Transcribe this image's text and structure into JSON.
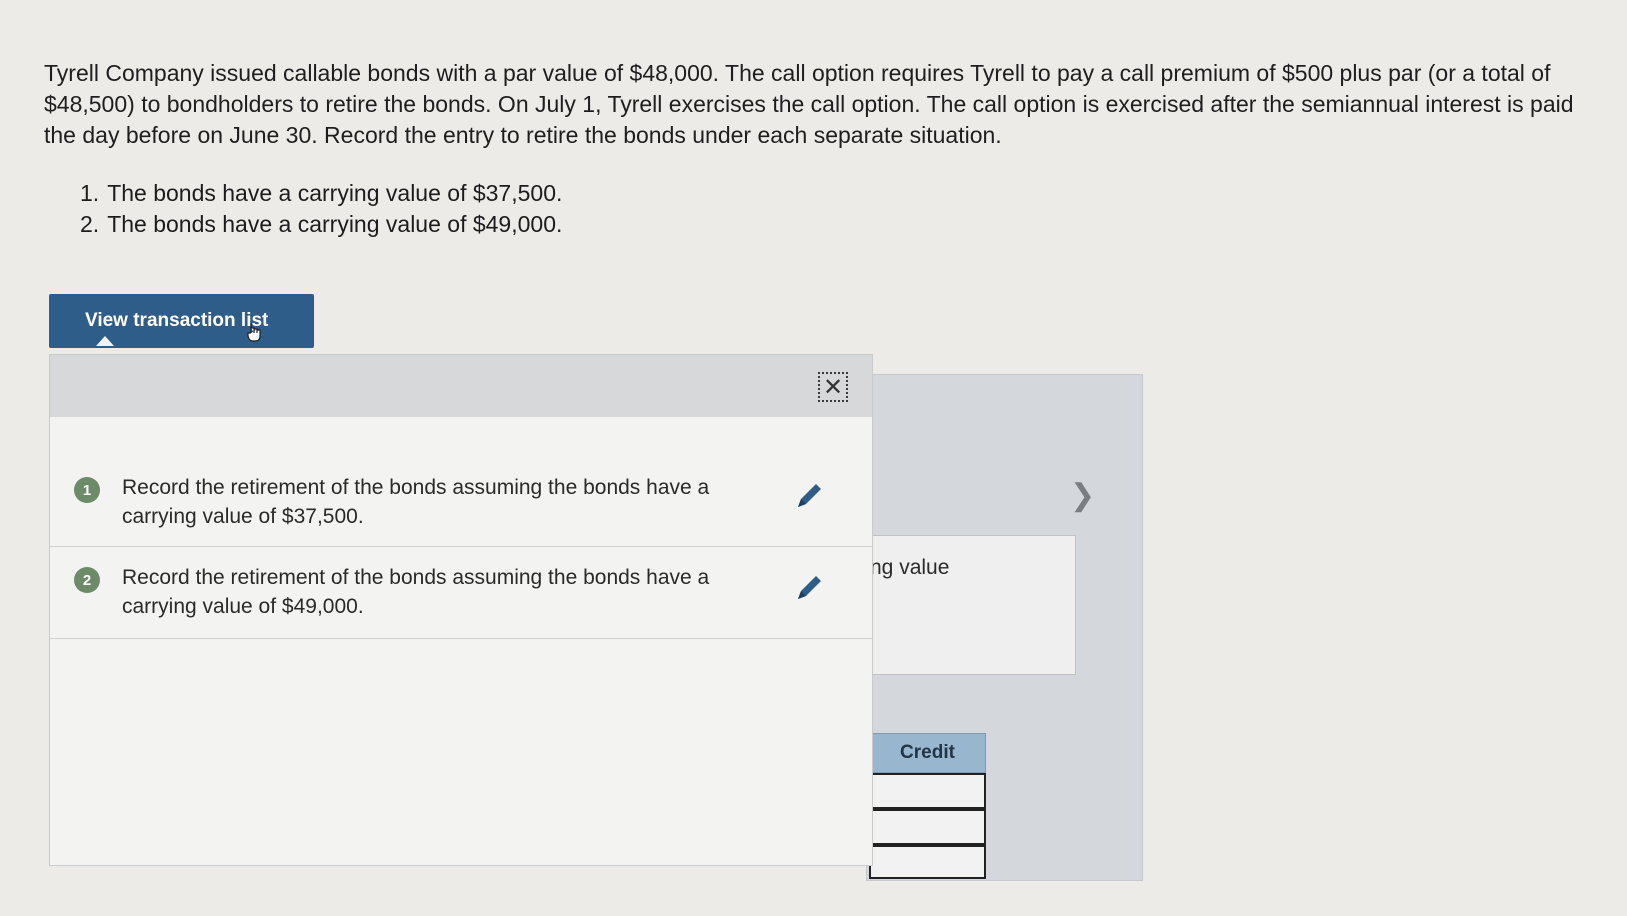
{
  "problem": {
    "text": "Tyrell Company issued callable bonds with a par value of $48,000. The call option requires Tyrell to pay a call premium of $500 plus par (or a total of $48,500) to bondholders to retire the bonds. On July 1, Tyrell exercises the call option. The call option is exercised after the semiannual interest is paid the day before on June 30. Record the entry to retire the bonds under each separate situation.",
    "requirements": [
      {
        "num": "1.",
        "text": "The bonds have a carrying value of $37,500."
      },
      {
        "num": "2.",
        "text": "The bonds have a carrying value of $49,000."
      }
    ]
  },
  "view_button": {
    "label": "View transaction list"
  },
  "popup": {
    "close_icon": "close-icon",
    "items": [
      {
        "num": "1",
        "text": "Record the retirement of the bonds assuming the bonds have a carrying value of $37,500."
      },
      {
        "num": "2",
        "text": "Record the retirement of the bonds assuming the bonds have a carrying value of $49,000."
      }
    ]
  },
  "background": {
    "partial_label": "ng value",
    "credit_header": "Credit",
    "chevron_icon": "chevron-right-icon"
  },
  "colors": {
    "button": "#2f5d8a",
    "badge": "#6d8b68",
    "credit_header": "#98b6cd"
  }
}
